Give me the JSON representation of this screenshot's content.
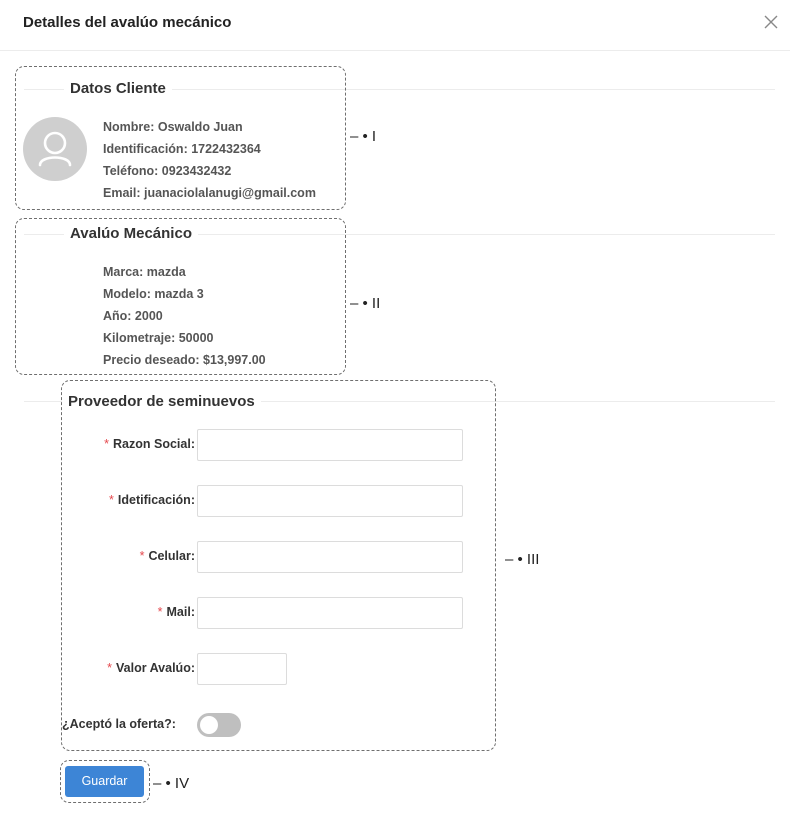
{
  "header": {
    "title": "Detalles del avalúo mecánico"
  },
  "cliente": {
    "title": "Datos Cliente",
    "nombre": "Nombre: Oswaldo Juan",
    "identificacion": "Identificación: 1722432364",
    "telefono": "Teléfono: 0923432432",
    "email": "Email: juanaciolalanugi@gmail.com"
  },
  "avaluo": {
    "title": "Avalúo Mecánico",
    "marca": "Marca: mazda",
    "modelo": "Modelo: mazda 3",
    "anio": "Año: 2000",
    "kilometraje": "Kilometraje: 50000",
    "precio": "Precio deseado: $13,997.00"
  },
  "proveedor": {
    "title": "Proveedor de seminuevos",
    "required_mark": "*",
    "fields": [
      {
        "label": "Razon Social",
        "value": ""
      },
      {
        "label": "Idetificación",
        "value": ""
      },
      {
        "label": "Celular",
        "value": ""
      },
      {
        "label": "Mail",
        "value": ""
      },
      {
        "label": "Valor Avalúo",
        "value": ""
      }
    ],
    "colon": ":",
    "toggle_label": "¿Aceptó la oferta?:",
    "toggle_on": false
  },
  "actions": {
    "save_label": "Guardar"
  },
  "annotations": {
    "marker_1": "– • I",
    "marker_2": "– • II",
    "marker_3": "– • III",
    "marker_4": "– • IV"
  },
  "icons": {
    "close": "close-icon",
    "avatar": "user-icon"
  },
  "colors": {
    "primary": "#3d85d6",
    "required": "#e5484d",
    "toggle_off": "#bfbfbf"
  }
}
